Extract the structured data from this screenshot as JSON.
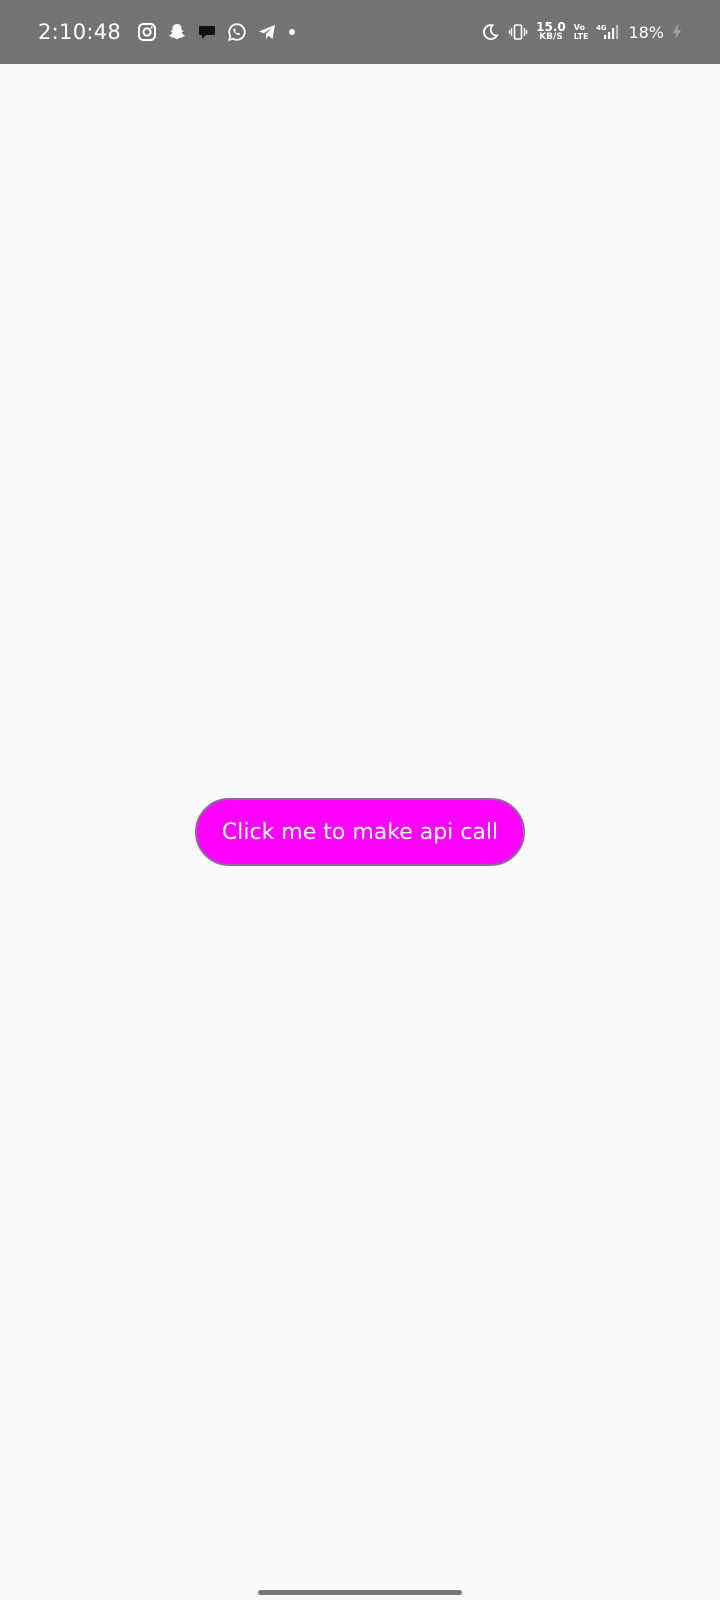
{
  "status_bar": {
    "time": "2:10:48",
    "left_icons": [
      "instagram-icon",
      "snapchat-icon",
      "chat-bubble-icon",
      "whatsapp-icon",
      "telegram-icon"
    ],
    "network_speed_value": "15.0",
    "network_speed_unit": "KB/S",
    "volte_top": "Vo",
    "volte_bottom": "LTE",
    "network_type": "4G",
    "battery": "18%"
  },
  "main": {
    "button_label": "Click me to make api call"
  },
  "colors": {
    "status_bar_bg": "#737373",
    "background": "#fafafa",
    "button_bg": "#ff00ff",
    "button_border": "#8e6b9a",
    "button_text": "#ffffff"
  }
}
